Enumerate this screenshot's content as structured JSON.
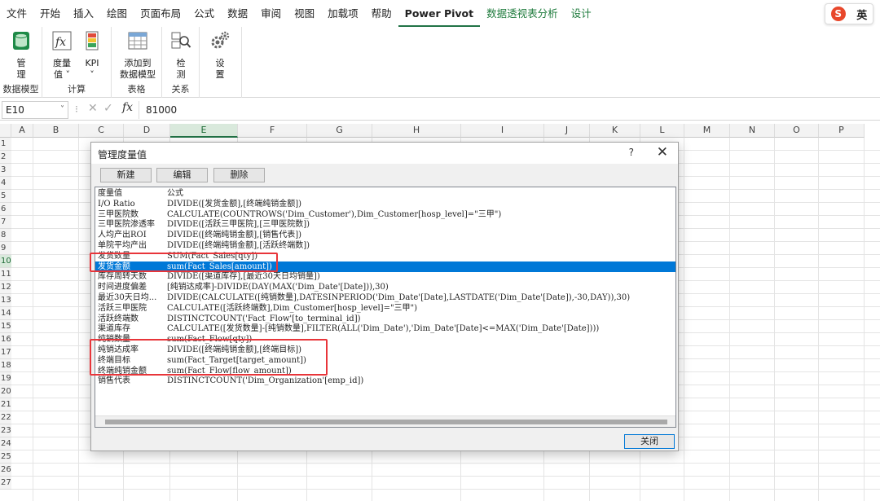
{
  "ribbon_tabs": [
    {
      "label": "文件",
      "style": "normal"
    },
    {
      "label": "开始",
      "style": "normal"
    },
    {
      "label": "插入",
      "style": "normal"
    },
    {
      "label": "绘图",
      "style": "normal"
    },
    {
      "label": "页面布局",
      "style": "normal"
    },
    {
      "label": "公式",
      "style": "normal"
    },
    {
      "label": "数据",
      "style": "normal"
    },
    {
      "label": "审阅",
      "style": "normal"
    },
    {
      "label": "视图",
      "style": "normal"
    },
    {
      "label": "加载项",
      "style": "normal"
    },
    {
      "label": "帮助",
      "style": "normal"
    },
    {
      "label": "Power Pivot",
      "style": "active"
    },
    {
      "label": "数据透视表分析",
      "style": "green"
    },
    {
      "label": "设计",
      "style": "green"
    }
  ],
  "ime": {
    "logo": "S",
    "mode": "英"
  },
  "ribbon": {
    "groups": {
      "data_model": "数据模型",
      "calc": "计算",
      "tables": "表格",
      "relations": "关系"
    },
    "buttons": {
      "manage_1": "管",
      "manage_2": "理",
      "measures_1": "度量",
      "measures_2": "值 ˅",
      "kpi_1": "KPI",
      "kpi_2": "˅",
      "add_1": "添加到",
      "add_2": "数据模型",
      "detect_1": "检",
      "detect_2": "测",
      "settings_1": "设",
      "settings_2": "置"
    }
  },
  "formula_bar": {
    "name_box": "E10",
    "dropdown": "˅",
    "sep": "⁝",
    "cancel": "✕",
    "enter": "✓",
    "fx": "fx",
    "value": "81000"
  },
  "columns": [
    "A",
    "B",
    "C",
    "D",
    "E",
    "F",
    "G",
    "H",
    "I",
    "J",
    "K",
    "L",
    "M",
    "N",
    "O",
    "P"
  ],
  "rows": [
    "1",
    "2",
    "3",
    "4",
    "5",
    "6",
    "7",
    "8",
    "9",
    "10",
    "11",
    "12",
    "13",
    "14",
    "15",
    "16",
    "17",
    "18",
    "19",
    "20",
    "21",
    "22",
    "23",
    "24",
    "25",
    "26",
    "27"
  ],
  "selected_cell": {
    "column": "E",
    "row": "10"
  },
  "dialog": {
    "title": "管理度量值",
    "help": "?",
    "close": "✕",
    "new_btn": "新建",
    "edit_btn": "编辑",
    "delete_btn": "删除",
    "header_name": "度量值",
    "header_formula": "公式",
    "measures": [
      {
        "name": "I/O Ratio",
        "formula": "DIVIDE([发货金额],[终端纯销金额])"
      },
      {
        "name": "三甲医院数",
        "formula": "CALCULATE(COUNTROWS('Dim_Customer'),Dim_Customer[hosp_level]=\"三甲\")"
      },
      {
        "name": "三甲医院渗透率",
        "formula": "DIVIDE([活跃三甲医院],[三甲医院数])"
      },
      {
        "name": "人均产出ROI",
        "formula": "DIVIDE([终端纯销金额],[销售代表])"
      },
      {
        "name": "单院平均产出",
        "formula": "DIVIDE([终端纯销金额],[活跃终端数])"
      },
      {
        "name": "发货数量",
        "formula": "SUM(Fact_Sales[qty])"
      },
      {
        "name": "发货金额",
        "formula": "sum(Fact_Sales[amount])"
      },
      {
        "name": "库存周转天数",
        "formula": "DIVIDE([渠道库存],[最近30天日均销量])"
      },
      {
        "name": "时间进度偏差",
        "formula": "[纯销达成率]-DIVIDE(DAY(MAX('Dim_Date'[Date])),30)"
      },
      {
        "name": "最近30天日均...",
        "formula": "DIVIDE(CALCULATE([纯销数量],DATESINPERIOD('Dim_Date'[Date],LASTDATE('Dim_Date'[Date]),-30,DAY)),30)"
      },
      {
        "name": "活跃三甲医院",
        "formula": "CALCULATE([活跃终端数],Dim_Customer[hosp_level]=\"三甲\")"
      },
      {
        "name": "活跃终端数",
        "formula": "DISTINCTCOUNT('Fact_Flow'[to_terminal_id])"
      },
      {
        "name": "渠道库存",
        "formula": "CALCULATE([发货数量]-[纯销数量],FILTER(ALL('Dim_Date'),'Dim_Date'[Date]<=MAX('Dim_Date'[Date])))"
      },
      {
        "name": "纯销数量",
        "formula": "sum(Fact_Flow[qty])"
      },
      {
        "name": "纯销达成率",
        "formula": "DIVIDE([终端纯销金额],[终端目标])"
      },
      {
        "name": "终端目标",
        "formula": "sum(Fact_Target[target_amount])"
      },
      {
        "name": "终端纯销金额",
        "formula": "sum(Fact_Flow[flow_amount])"
      },
      {
        "name": "销售代表",
        "formula": "DISTINCTCOUNT('Dim_Organization'[emp_id])"
      }
    ],
    "selected_index": 6,
    "ok_btn": "关闭"
  },
  "colors": {
    "accent_green": "#217346",
    "selection_blue": "#0078d7",
    "annotation_red": "#e8353a"
  }
}
